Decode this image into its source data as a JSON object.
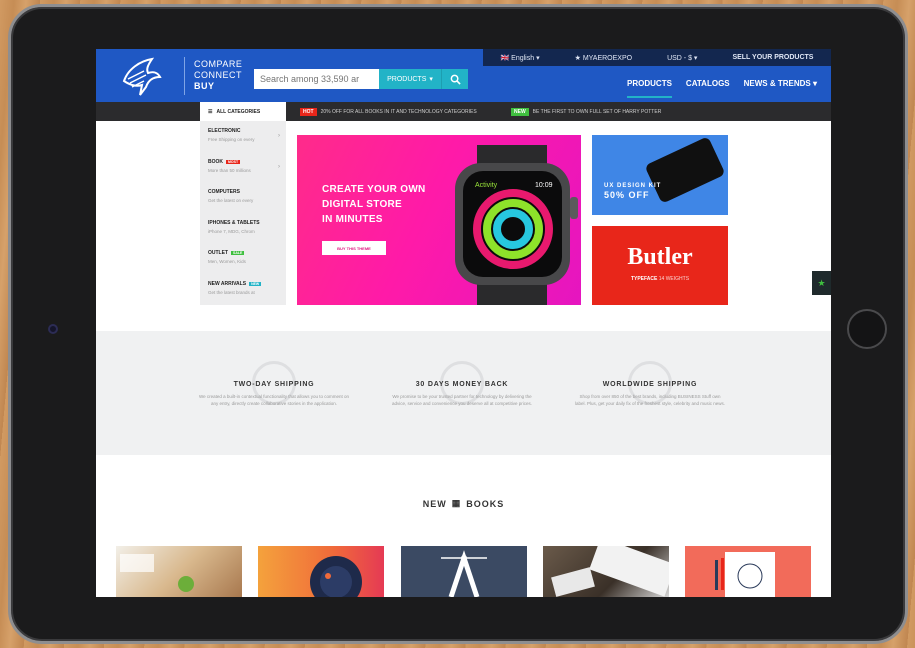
{
  "brand": {
    "line1": "COMPARE",
    "line2": "CONNECT",
    "line3": "BUY",
    "accent": "#1f58c4",
    "accent2": "#22b3c7"
  },
  "topbar": {
    "language": "English",
    "myaeroexpo": "MYAEROEXPO",
    "currency": "USD - $",
    "sell": "SELL YOUR PRODUCTS"
  },
  "search": {
    "placeholder": "Search among 33,590 ar",
    "category": "PRODUCTS"
  },
  "nav": {
    "items": [
      {
        "label": "PRODUCTS"
      },
      {
        "label": "CATALOGS"
      },
      {
        "label": "NEWS & TRENDS"
      }
    ]
  },
  "subbar": {
    "all_categories": "ALL CATEGORIES",
    "promo1_tag": "HOT",
    "promo1_text": "20% OFF FOR ALL BOOKS IN IT AND TECHNOLOGY CATEGORIES",
    "promo2_tag": "NEW",
    "promo2_text": "BE THE FIRST TO OWN FULL SET OF HARRY POTTER"
  },
  "categories": [
    {
      "title": "ELECTRONIC",
      "sub": "Free Shipping on every",
      "badge": ""
    },
    {
      "title": "BOOK",
      "sub": "More than 50 millions",
      "badge": "MOST"
    },
    {
      "title": "COMPUTERS",
      "sub": "Get the latest on every",
      "badge": ""
    },
    {
      "title": "IPHONES & TABLETS",
      "sub": "iPhone 7, MDG, Chrom",
      "badge": ""
    },
    {
      "title": "OUTLET",
      "sub": "Men, Women, Kids",
      "badge": "SALE"
    },
    {
      "title": "NEW ARRIVALS",
      "sub": "Get the latest brands at",
      "badge": "NEW"
    }
  ],
  "hero": {
    "line1": "CREATE YOUR OWN",
    "line2": "DIGITAL STORE",
    "line3": "IN MINUTES",
    "button": "BUY THIS THEME",
    "watch_time": "10:09",
    "watch_app": "Activity"
  },
  "uxkit": {
    "line1": "UX DESIGN KIT",
    "line2": "50% OFF"
  },
  "butler": {
    "title": "Butler",
    "sub_bold": "TYPEFACE",
    "sub_light": "14 WEIGHTS"
  },
  "features": [
    {
      "title": "TWO-DAY SHIPPING",
      "desc": "We created a built-in contextual functionality that allows you to comment on any entry, directly create collaborative stories in the application."
    },
    {
      "title": "30 DAYS MONEY BACK",
      "desc": "We promise to be your trusted partner for technology by delivering the advice, service and convenience you deserve all at competitive prices."
    },
    {
      "title": "WORLDWIDE SHIPPING",
      "desc": "Shop from over 850 of the best brands, including BUSINESS Stuff own label. Plus, get your daily fix of the freshest style, celebrity and music news."
    }
  ],
  "new_books": {
    "title_left": "NEW",
    "title_right": "BOOKS"
  }
}
